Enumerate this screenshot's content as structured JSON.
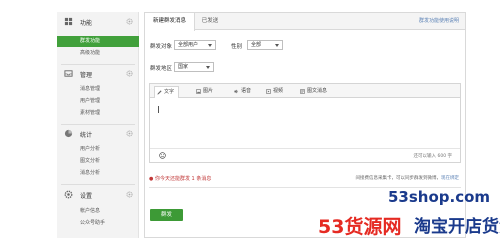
{
  "sidebar": {
    "sections": [
      {
        "label": "功能",
        "items": [
          {
            "label": "群发功能",
            "active": true
          },
          {
            "label": "高级功能",
            "active": false
          }
        ]
      },
      {
        "label": "管理",
        "items": [
          {
            "label": "消息管理",
            "active": false
          },
          {
            "label": "用户管理",
            "active": false
          },
          {
            "label": "素材管理",
            "active": false
          }
        ]
      },
      {
        "label": "统计",
        "items": [
          {
            "label": "用户分析",
            "active": false
          },
          {
            "label": "图文分析",
            "active": false
          },
          {
            "label": "消息分析",
            "active": false
          }
        ]
      },
      {
        "label": "设置",
        "items": [
          {
            "label": "帐户信息",
            "active": false
          },
          {
            "label": "公众号助手",
            "active": false
          }
        ]
      }
    ]
  },
  "tabs": {
    "new": "新建群发消息",
    "sent": "已发送",
    "help": "群发功能使用说明"
  },
  "form": {
    "target_label": "群发对象",
    "target_value": "全部用户",
    "gender_label": "性别",
    "gender_value": "全部",
    "region_label": "群发地区",
    "region_value": "国家"
  },
  "editor": {
    "tabs": [
      {
        "label": "文字"
      },
      {
        "label": "图片"
      },
      {
        "label": "语音"
      },
      {
        "label": "视频"
      },
      {
        "label": "图文消息"
      }
    ],
    "counter": "还可以输入 600 字"
  },
  "warning": "你今天还能群发 1 条消息",
  "note_text": "间接费信息采集卡，可以同步群发到微博，",
  "note_link": "现在绑定",
  "send_label": "群发",
  "watermark": {
    "brand": "53货源网",
    "domain": "53shop.com",
    "tagline": "淘宝开店货源"
  },
  "colors": {
    "accent": "#41a03b",
    "link": "#5d83b6",
    "warning": "#c23a3a",
    "wm_red": "#e52a22",
    "wm_blue": "#1a3a8c"
  }
}
